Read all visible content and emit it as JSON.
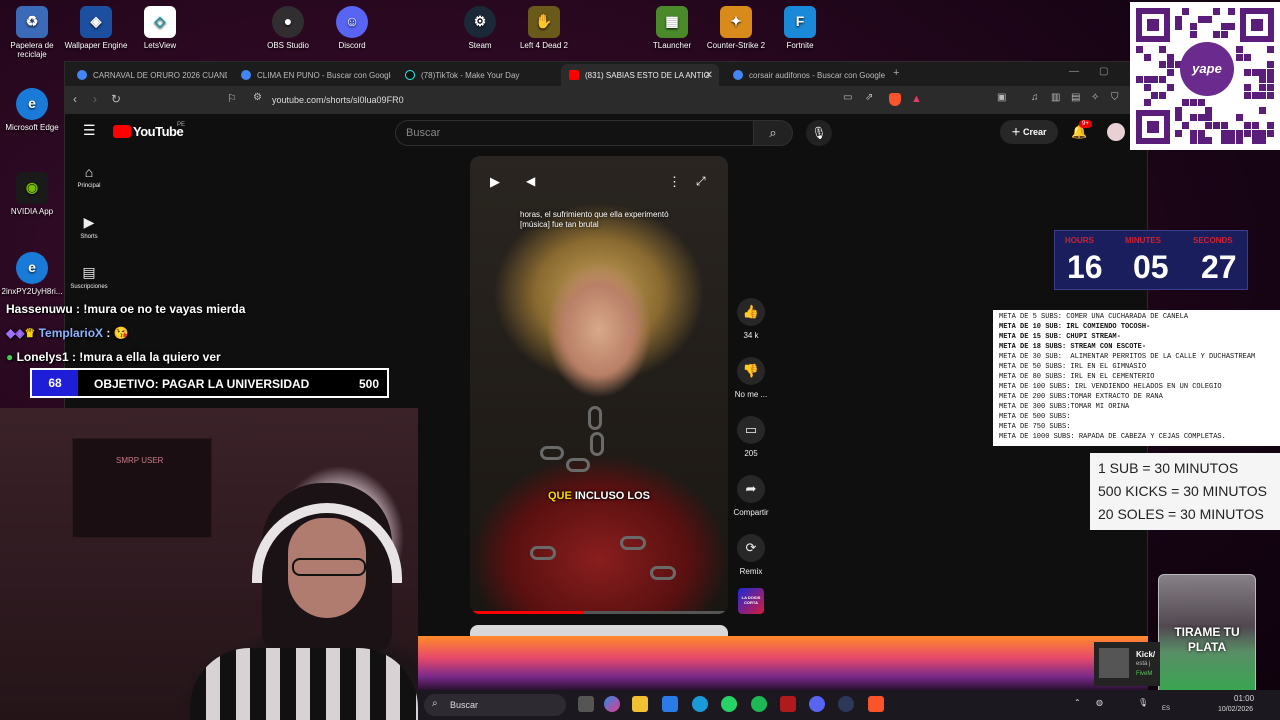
{
  "desktop": {
    "icons": [
      {
        "label": "Papelera de reciclaje",
        "icon": "recycle-bin-icon",
        "color": "#3a7bd5"
      },
      {
        "label": "Wallpaper Engine",
        "icon": "wallpaper-engine-icon",
        "color": "#1c4fa0"
      },
      {
        "label": "LetsView",
        "icon": "letsview-icon",
        "color": "#ffffff"
      },
      {
        "label": "OBS Studio",
        "icon": "obs-icon",
        "color": "#302e31"
      },
      {
        "label": "Discord",
        "icon": "discord-icon",
        "color": "#5865f2"
      },
      {
        "label": "Steam",
        "icon": "steam-icon",
        "color": "#1b2838"
      },
      {
        "label": "Left 4 Dead 2",
        "icon": "left4dead2-icon",
        "color": "#6a5a1a"
      },
      {
        "label": "TLauncher",
        "icon": "tlauncher-icon",
        "color": "#4a8a2a"
      },
      {
        "label": "Counter-Strike 2",
        "icon": "cs2-icon",
        "color": "#d88a1a"
      },
      {
        "label": "Fortnite",
        "icon": "fortnite-icon",
        "color": "#1a8ad8"
      },
      {
        "label": "Microsoft Edge",
        "icon": "edge-icon",
        "color": "#1a7ad8"
      },
      {
        "label": "NVIDIA App",
        "icon": "nvidia-icon",
        "color": "#1a1a1a"
      },
      {
        "label": "2inxPY2UyH8ri...",
        "icon": "edge-file-icon",
        "color": "#1a7ad8"
      }
    ]
  },
  "browser": {
    "tabs": [
      {
        "title": "CARNAVAL DE ORURO 2026 CUANDO",
        "favicon": "google-icon",
        "color": "#4285f4"
      },
      {
        "title": "CLIMA EN PUNO - Buscar con Google",
        "favicon": "google-icon",
        "color": "#4285f4"
      },
      {
        "title": "(78)TikTok - Make Your Day",
        "favicon": "tiktok-icon",
        "color": "#111111"
      },
      {
        "title": "(831) SABIAS ESTO DE LA ANTIG",
        "favicon": "youtube-icon",
        "color": "#ff0000"
      },
      {
        "title": "corsair audifonos - Buscar con Google",
        "favicon": "google-icon",
        "color": "#4285f4"
      }
    ],
    "url": "youtube.com/shorts/sl0lua09FR0"
  },
  "youtube": {
    "logo": "YouTube",
    "region": "PE",
    "search_placeholder": "Buscar",
    "create_label": "Crear",
    "notif_badge": "9+",
    "sidebar": [
      {
        "label": "Principal",
        "icon": "home-icon"
      },
      {
        "label": "Shorts",
        "icon": "shorts-icon"
      },
      {
        "label": "Suscripciones",
        "icon": "subscriptions-icon"
      }
    ],
    "video": {
      "caption_top": "horas, el sufrimiento que ella experimentó [música] fue tan brutal",
      "caption_highlight": "QUE",
      "caption_rest": " INCLUSO LOS",
      "progress_fraction": 0.44
    },
    "actions": [
      {
        "label": "34 k",
        "icon": "like-icon"
      },
      {
        "label": "No me ...",
        "icon": "dislike-icon"
      },
      {
        "label": "205",
        "icon": "comment-icon"
      },
      {
        "label": "Compartir",
        "icon": "share-icon"
      },
      {
        "label": "Remix",
        "icon": "remix-icon"
      }
    ],
    "channel_badge": "LA DOSIS CORTA"
  },
  "stream": {
    "chat": [
      {
        "user": "Hassenuwu",
        "message": "!mura oe no te vayas mierda",
        "color": "#ffffff"
      },
      {
        "user": "TemplarioX",
        "message": "😘",
        "color": "#8ab4ff"
      },
      {
        "user": "Lonelys1",
        "message": "!mura a ella la quiero ver",
        "color": "#ffffff"
      }
    ],
    "goal": {
      "current": "68",
      "label": "OBJETIVO: PAGAR LA UNIVERSIDAD",
      "target": "500"
    },
    "webcam_text": "SMRP USER",
    "timer": {
      "hours_label": "HOURS",
      "minutes_label": "MINUTES",
      "seconds_label": "SECONDS",
      "hours": "16",
      "minutes": "05",
      "seconds": "27"
    },
    "qr_label": "yape",
    "goals_list": [
      {
        "text": "META DE 5 SUBS: COMER UNA CUCHARADA DE CANELA",
        "bold": false
      },
      {
        "text": "META DE 10 SUB: IRL COMIENDO TOCOSH-",
        "bold": true
      },
      {
        "text": "META DE 15 SUB: CHUPI STREAM-",
        "bold": true
      },
      {
        "text": "META DE 18 SUBS: STREAM CON ESCOTE-",
        "bold": true
      },
      {
        "text": "META DE 30 SUB:  ALIMENTAR PERRITOS DE LA CALLE Y DUCHASTREAM",
        "bold": false
      },
      {
        "text": "META DE 50 SUBS: IRL EN EL GIMNASIO",
        "bold": false
      },
      {
        "text": "META DE 80 SUBS: IRL EN EL CEMENTERIO",
        "bold": false
      },
      {
        "text": "META DE 100 SUBS: IRL VENDIENDO HELADOS EN UN COLEGIO",
        "bold": false
      },
      {
        "text": "META DE 200 SUBS:TOMAR EXTRACTO DE RANA",
        "bold": false
      },
      {
        "text": "META DE 300 SUBS:TOMAR MI ORINA",
        "bold": false
      },
      {
        "text": "META DE 500 SUBS:",
        "bold": false
      },
      {
        "text": "META DE 750 SUBS:",
        "bold": false
      },
      {
        "text": "META DE 1000 SUBS: RAPADA DE CABEZA Y CEJAS COMPLETAS.",
        "bold": false
      }
    ],
    "rates": [
      "1 SUB = 30 MINUTOS",
      "500 KICKS = 30 MINUTOS",
      "20 SOLES = 30 MINUTOS"
    ],
    "jar_text": "TIRAME TU PLATA"
  },
  "taskbar": {
    "search_placeholder": "Buscar",
    "time": "01:00",
    "date": "10/02/2026",
    "lang": "ES",
    "notification": {
      "title": "Kick/",
      "line1": "está j",
      "line2": "FiveM"
    }
  }
}
